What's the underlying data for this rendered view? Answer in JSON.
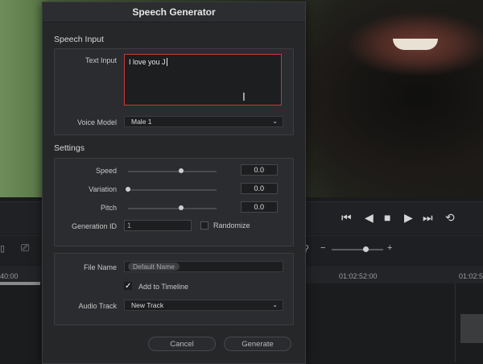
{
  "dialog": {
    "title": "Speech Generator",
    "speech_input": {
      "section_label": "Speech Input",
      "text_input_label": "Text Input",
      "text_input_value": "I love you J",
      "voice_model_label": "Voice Model",
      "voice_model_value": "Male 1"
    },
    "settings": {
      "section_label": "Settings",
      "speed": {
        "label": "Speed",
        "value": "0.0",
        "slider_fraction": 0.6
      },
      "variation": {
        "label": "Variation",
        "value": "0.0",
        "slider_fraction": 0.0
      },
      "pitch": {
        "label": "Pitch",
        "value": "0.0",
        "slider_fraction": 0.6
      },
      "generation_id": {
        "label": "Generation ID",
        "value": "1"
      },
      "randomize": {
        "label": "Randomize",
        "checked": false
      }
    },
    "output": {
      "file_name_label": "File Name",
      "file_name_placeholder": "Default Name",
      "add_to_timeline": {
        "label": "Add to Timeline",
        "checked": true,
        "check_glyph": "✓"
      },
      "audio_track_label": "Audio Track",
      "audio_track_value": "New Track"
    },
    "buttons": {
      "cancel": "Cancel",
      "generate": "Generate"
    }
  },
  "timeline": {
    "timecodes": [
      "40:00",
      "01:02:52:00",
      "01:02:5"
    ]
  },
  "icons": {
    "chevron": "chevron-down-icon",
    "transport": [
      "skip-back-icon",
      "play-reverse-icon",
      "stop-icon",
      "play-icon",
      "skip-forward-icon",
      "loop-icon"
    ]
  },
  "colors": {
    "focus_border": "#c43a3a",
    "dialog_bg": "#262729"
  }
}
